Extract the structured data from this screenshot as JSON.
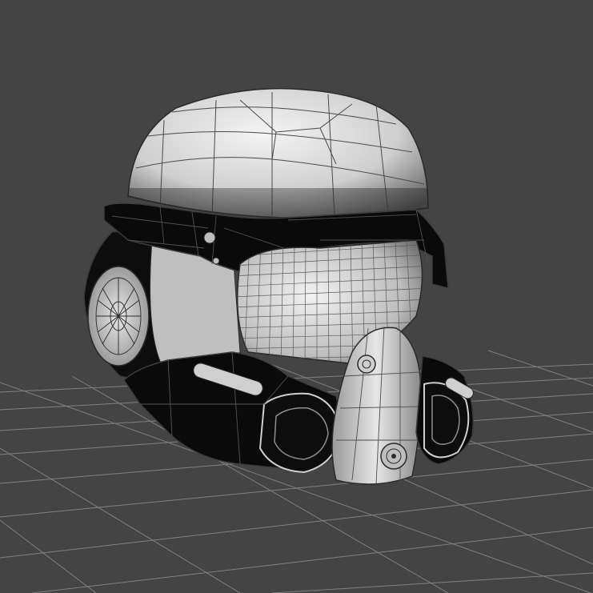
{
  "viewport": {
    "background": "#444444",
    "grid_color": "#8a8a8a",
    "wire_color": "#2a2a2a"
  },
  "model": {
    "subject": "helmet-wireframe-render",
    "shell_color": "#d8d8d8",
    "dark_panel_color": "#0b0b0b",
    "visor_color": "#cfcfcf"
  }
}
